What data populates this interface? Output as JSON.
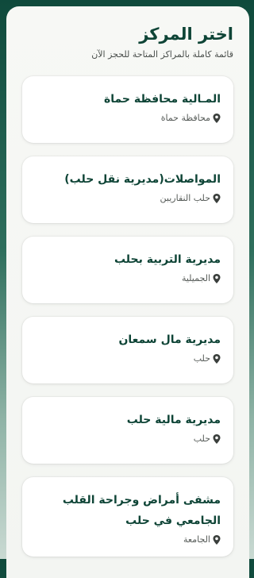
{
  "header": {
    "title": "اختر المركز",
    "subtitle": "قائمة كاملة بالمراكز المتاحة للحجز الآن"
  },
  "centers": [
    {
      "name": "المـالية محافظة حماة",
      "location": "محافظة حماة"
    },
    {
      "name": "المواصلات(مديرية نقل حلب)",
      "location": "حلب النقاريبن"
    },
    {
      "name": "مديرية التربية بحلب",
      "location": "الجميلية"
    },
    {
      "name": "مديرية مال سمعان",
      "location": "حلب"
    },
    {
      "name": "مديرية مالية حلب",
      "location": "حلب"
    },
    {
      "name": "مشفى أمراض وجراحة القلب الجامعي في حلب",
      "location": "الجامعة"
    }
  ],
  "icons": {
    "location": "map-pin-icon"
  },
  "colors": {
    "brand": "#0e4436",
    "background": "#0f4a3c",
    "card": "#ffffff"
  }
}
